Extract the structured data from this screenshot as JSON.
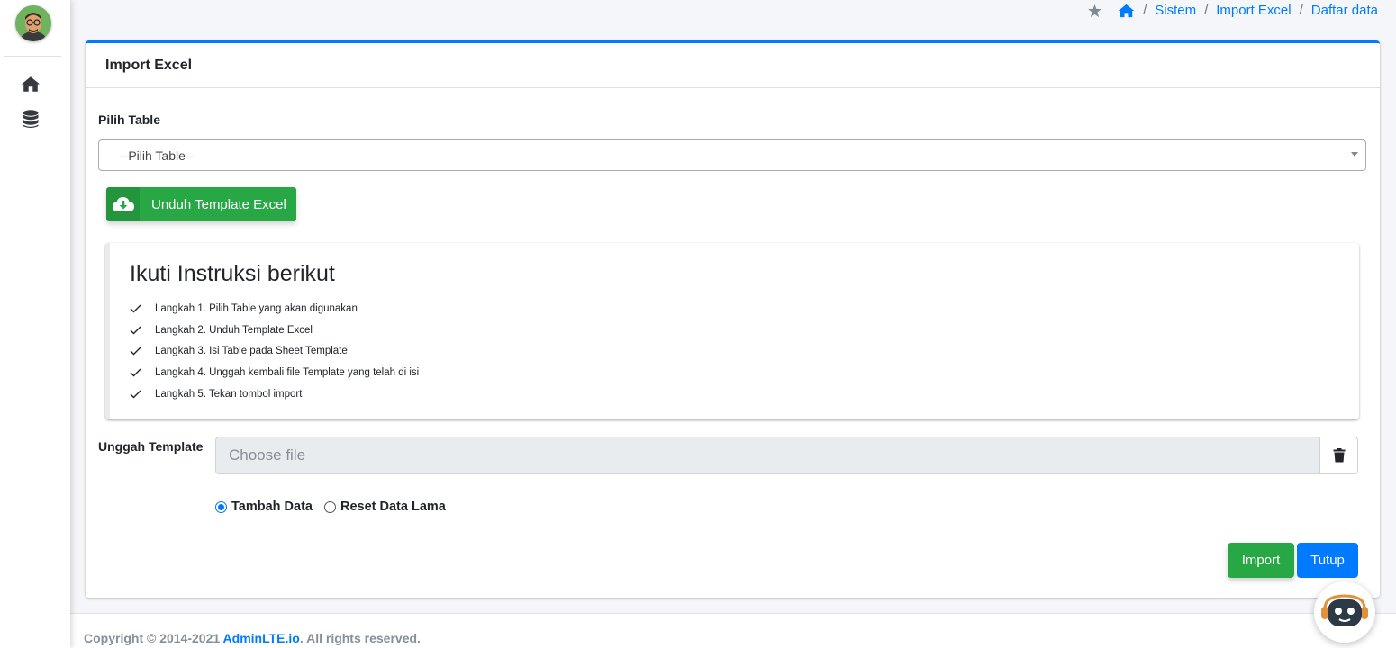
{
  "sidebar": {
    "avatar": "user-avatar",
    "items": [
      {
        "icon": "home-icon"
      },
      {
        "icon": "database-icon"
      }
    ]
  },
  "breadcrumb": {
    "items": [
      "Sistem",
      "Import Excel",
      "Daftar data"
    ],
    "separator": "/"
  },
  "card": {
    "title": "Import Excel",
    "table_label": "Pilih Table",
    "table_select_value": "--Pilih Table--",
    "download_button_label": "Unduh Template Excel",
    "instructions": {
      "title": "Ikuti Instruksi berikut",
      "steps": [
        "Langkah 1. Pilih Table yang akan digunakan",
        "Langkah 2. Unduh Template Excel",
        "Langkah 3. Isi Table pada Sheet Template",
        "Langkah 4. Unggah kembali file Template yang telah di isi",
        "Langkah 5. Tekan tombol import"
      ]
    },
    "upload_label": "Unggah Template",
    "file_placeholder": "Choose file",
    "radio_options": [
      {
        "label": "Tambah Data",
        "checked": true
      },
      {
        "label": "Reset Data Lama",
        "checked": false
      }
    ],
    "import_button": "Import",
    "close_button": "Tutup"
  },
  "footer": {
    "copyright": "Copyright © 2014-2021 ",
    "brand": "AdminLTE.io",
    "rights": ". All rights reserved."
  },
  "colors": {
    "primary": "#007bff",
    "success": "#28a745",
    "text_muted": "#6c757d"
  }
}
